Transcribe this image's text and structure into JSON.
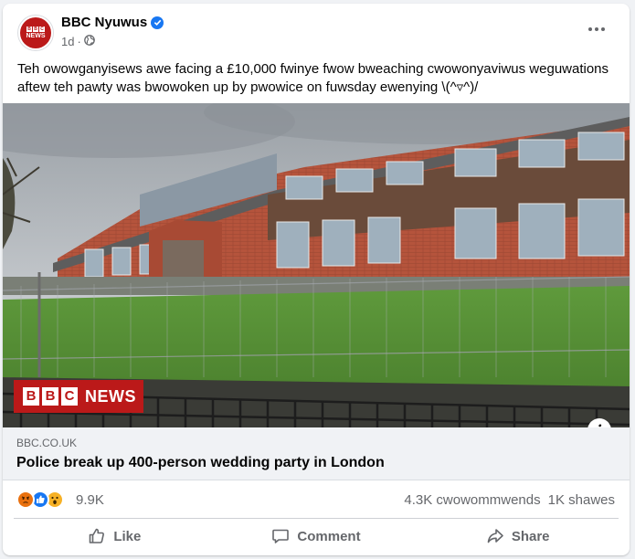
{
  "post": {
    "page_name": "BBC Nyuwus",
    "time": "1d",
    "separator": "·",
    "text": "Teh owowganyisews awe facing a £10,000 fwinye fwow bweaching cwowonyaviwus weguwations aftew teh pawty was bwowoken up by pwowice on fuwsday ewenying  \\(^▿^)/",
    "avatar_text": {
      "letters": [
        "B",
        "B",
        "C"
      ],
      "news": "NEWS"
    }
  },
  "image_overlay": {
    "letters": [
      "B",
      "B",
      "C"
    ],
    "news": "NEWS",
    "info": "i"
  },
  "link": {
    "domain": "BBC.CO.UK",
    "title": "Police break up 400-person wedding party in London"
  },
  "engagement": {
    "reaction_count": "9.9K",
    "comments": "4.3K cwowommwends",
    "shares": "1K shawes"
  },
  "actions": {
    "like": "Like",
    "comment": "Comment",
    "share": "Share"
  },
  "colors": {
    "bbc_red": "#bb1919",
    "facebook_blue": "#1877f2",
    "angry": "#e9710f",
    "wow": "#f7b125"
  }
}
